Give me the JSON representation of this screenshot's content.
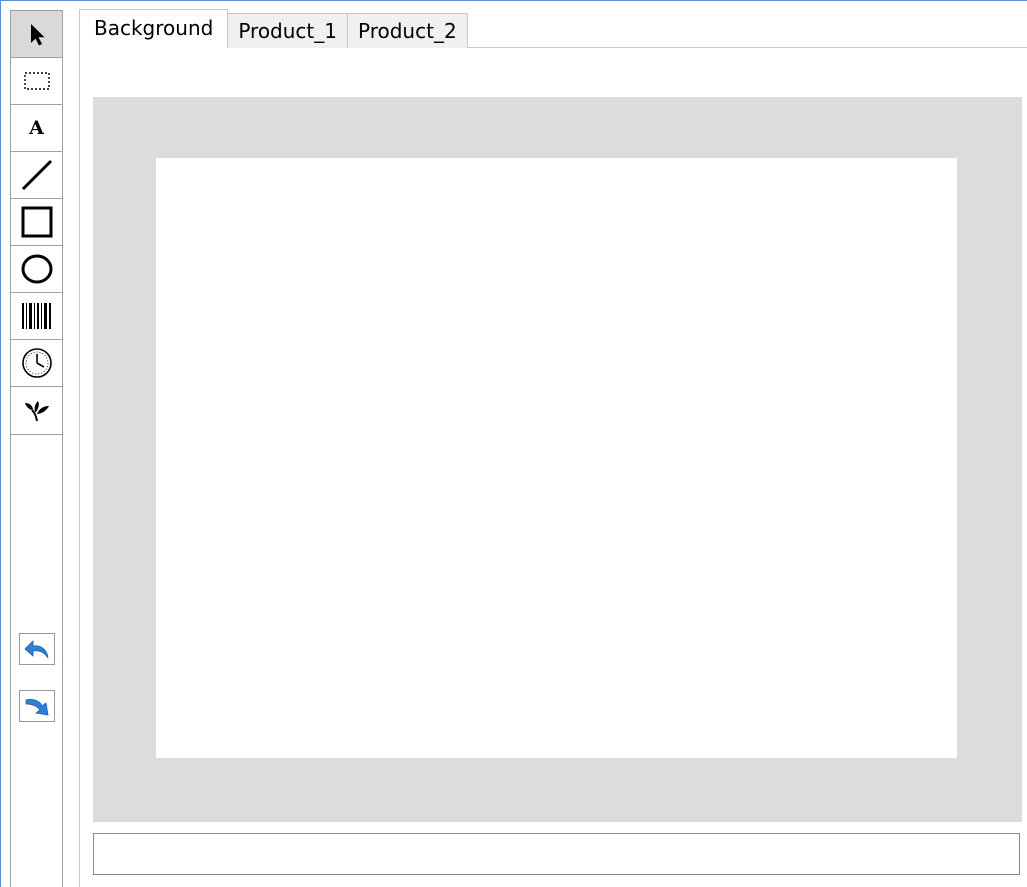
{
  "tabs": [
    "Background",
    "Product_1",
    "Product_2"
  ],
  "active_tab": "Background",
  "toolbox": {
    "tools": [
      "pointer-tool",
      "select-rectangle-tool",
      "text-tool",
      "line-tool",
      "rectangle-tool",
      "ellipse-tool",
      "barcode-tool",
      "clock-tool",
      "image-tool"
    ],
    "active_tool": "pointer-tool",
    "undo_icon": "undo-arrow-icon",
    "redo_icon": "redo-arrow-icon",
    "text_glyph": "A"
  },
  "status": {
    "value": ""
  },
  "colors": {
    "canvas_background": "#dcdcdc",
    "page": "#ffffff",
    "active_tool": "#d9d9d9",
    "arrow_blue": "#2f7ed8"
  }
}
